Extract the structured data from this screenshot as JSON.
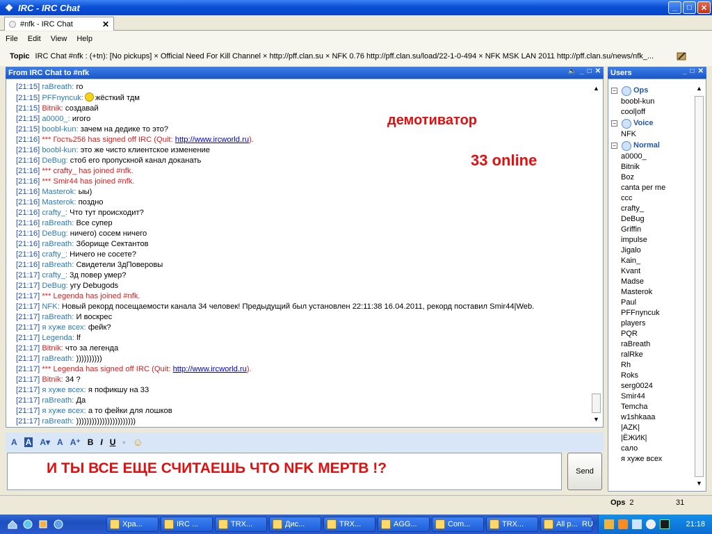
{
  "window": {
    "title": "IRC - IRC Chat",
    "btn_min": "_",
    "btn_max": "□",
    "btn_close": "✕"
  },
  "tab": {
    "label": "#nfk - IRC Chat",
    "close": "✕"
  },
  "menu": [
    "File",
    "Edit",
    "View",
    "Help"
  ],
  "topic": {
    "label": "Topic",
    "text": "IRC Chat #nfk : (+tn): [No pickups] × Official Need For Kill Channel × http://pff.clan.su × NFK 0.76 http://pff.clan.su/load/22-1-0-494 × NFK MSK LAN 2011 http://pff.clan.su/news/nfk_..."
  },
  "chat_panel": {
    "title": "From IRC Chat to #nfk",
    "btns": [
      "🔈",
      "_",
      "□",
      "✕"
    ]
  },
  "overlay": {
    "demotivator": "демотиватор",
    "online": "33 online"
  },
  "messages": [
    {
      "ts": "[21:15]",
      "nick": "raBreath:",
      "text": "го",
      "kind": "nick"
    },
    {
      "ts": "[21:15]",
      "nick": "PFFnyncuk:",
      "text": "жёсткий тдм",
      "kind": "nick",
      "smile": true
    },
    {
      "ts": "[21:15]",
      "nick": "Bitnik:",
      "text": "создавай",
      "kind": "red"
    },
    {
      "ts": "[21:15]",
      "nick": "a0000_:",
      "text": "игого",
      "kind": "nick"
    },
    {
      "ts": "[21:15]",
      "nick": "boobl-kun:",
      "text": "зачем на дедике то это?",
      "kind": "nick"
    },
    {
      "ts": "[21:16]",
      "nick": "*** Гость256 has signed off IRC (Quit:",
      "text": "",
      "kind": "sysquit",
      "link": "http://www.ircworld.ru",
      "after": ")."
    },
    {
      "ts": "[21:16]",
      "nick": "boobl-kun:",
      "text": "это же чисто клиентское изменение",
      "kind": "nick"
    },
    {
      "ts": "[21:16]",
      "nick": "DeBug:",
      "text": "стоб его пропускной канал доканать",
      "kind": "nick"
    },
    {
      "ts": "[21:16]",
      "nick": "*** crafty_ has joined #nfk.",
      "text": "",
      "kind": "sys"
    },
    {
      "ts": "[21:16]",
      "nick": "*** Smir44 has joined #nfk.",
      "text": "",
      "kind": "sys"
    },
    {
      "ts": "[21:16]",
      "nick": "Masterok:",
      "text": "ыы)",
      "kind": "nick"
    },
    {
      "ts": "[21:16]",
      "nick": "Masterok:",
      "text": "поздно",
      "kind": "nick"
    },
    {
      "ts": "[21:16]",
      "nick": "crafty_:",
      "text": "Что тут происходит?",
      "kind": "nick"
    },
    {
      "ts": "[21:16]",
      "nick": "raBreath:",
      "text": "Все супер",
      "kind": "nick"
    },
    {
      "ts": "[21:16]",
      "nick": "DeBug:",
      "text": "ничего) сосем ничего",
      "kind": "nick"
    },
    {
      "ts": "[21:16]",
      "nick": "raBreath:",
      "text": "Зборище Сектантов",
      "kind": "nick"
    },
    {
      "ts": "[21:16]",
      "nick": "crafty_:",
      "text": "Ничего не сосете?",
      "kind": "nick"
    },
    {
      "ts": "[21:16]",
      "nick": "raBreath:",
      "text": "Свидетели 3дПоверовы",
      "kind": "nick"
    },
    {
      "ts": "[21:17]",
      "nick": "crafty_:",
      "text": "3д повер умер?",
      "kind": "nick"
    },
    {
      "ts": "[21:17]",
      "nick": "DeBug:",
      "text": "угу Debugods",
      "kind": "nick"
    },
    {
      "ts": "[21:17]",
      "nick": "*** Legenda has joined #nfk.",
      "text": "",
      "kind": "sys"
    },
    {
      "ts": "[21:17]",
      "nick": "NFK:",
      "text": "Новый рекорд посещаемости канала 34 человек! Предыдущий был установлен 22:11:38 16.04.2011, рекорд поставил Smir44|Web.",
      "kind": "nick"
    },
    {
      "ts": "[21:17]",
      "nick": "raBreath:",
      "text": "И воскрес",
      "kind": "nick"
    },
    {
      "ts": "[21:17]",
      "nick": "я хуже всех:",
      "text": "фейк?",
      "kind": "nick"
    },
    {
      "ts": "[21:17]",
      "nick": "Legenda:",
      "text": "lf",
      "kind": "nick"
    },
    {
      "ts": "[21:17]",
      "nick": "Bitnik:",
      "text": "что за легенда",
      "kind": "red"
    },
    {
      "ts": "[21:17]",
      "nick": "raBreath:",
      "text": "))))))))))",
      "kind": "nick"
    },
    {
      "ts": "[21:17]",
      "nick": "*** Legenda has signed off IRC (Quit:",
      "text": "",
      "kind": "sysquit",
      "link": "http://www.ircworld.ru",
      "after": ")."
    },
    {
      "ts": "[21:17]",
      "nick": "Bitnik:",
      "text": "34 ?",
      "kind": "red"
    },
    {
      "ts": "[21:17]",
      "nick": "я хуже всех:",
      "text": "я пофикшу на 33",
      "kind": "nick"
    },
    {
      "ts": "[21:17]",
      "nick": "raBreath:",
      "text": "Да",
      "kind": "nick"
    },
    {
      "ts": "[21:17]",
      "nick": "я хуже всех:",
      "text": "а то фейки для лошков",
      "kind": "nick"
    },
    {
      "ts": "[21:17]",
      "nick": "raBreath:",
      "text": ")))))))))))))))))))))))",
      "kind": "nick"
    }
  ],
  "format_tools": [
    "A",
    "A",
    "A▾",
    "A",
    "A⁺",
    "B",
    "I",
    "U",
    "▫",
    "☺"
  ],
  "input": {
    "value": "И ТЫ ВСЕ ЕЩЕ СЧИТАЕШЬ ЧТО NFK МЕРТВ !?"
  },
  "send_label": "Send",
  "users_panel": {
    "title": "Users",
    "btns": [
      "_",
      "□",
      "✕"
    ]
  },
  "groups": [
    {
      "name": "Ops",
      "users": [
        "boobl-kun",
        "cool|off"
      ]
    },
    {
      "name": "Voice",
      "users": [
        "NFK"
      ]
    },
    {
      "name": "Normal",
      "users": [
        "a0000_",
        "Bitnik",
        "Boz",
        "canta per me",
        "ccc",
        "crafty_",
        "DeBug",
        "Griffin",
        "impulse",
        "Jigalo",
        "Kain_",
        "Kvant",
        "Madse",
        "Masterok",
        "Paul",
        "PFFnyncuk",
        "players",
        "PQR",
        "raBreath",
        "ralRke",
        "Rh",
        "Roks",
        "serg0024",
        "Smir44",
        "Temcha",
        "w1shkaaa",
        "|AZK|",
        "|ЁЖИК|",
        "сало",
        "я хуже всех"
      ]
    }
  ],
  "status": {
    "ops_label": "Ops",
    "ops_count": "2",
    "total": "31"
  },
  "taskbar": {
    "tasks": [
      "Хра...",
      "IRC ...",
      "TRX...",
      "Дис...",
      "TRX...",
      "AGG...",
      "Com...",
      "TRX...",
      "All p..."
    ],
    "lang": "RU",
    "clock": "21:18"
  },
  "colors": {
    "accent": "#1c56c9",
    "nick": "#2a7ab8",
    "system": "#d81e1e",
    "overlay_red": "#e01010"
  }
}
